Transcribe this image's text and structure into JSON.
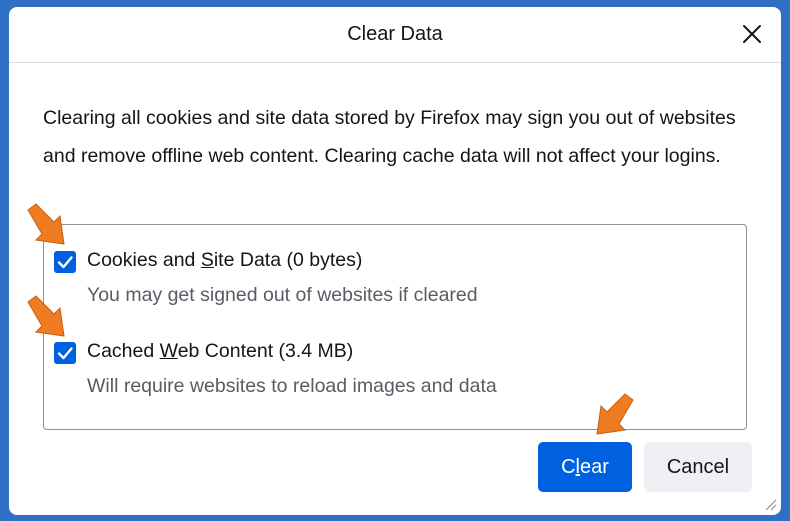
{
  "dialog": {
    "title": "Clear Data",
    "description": "Clearing all cookies and site data stored by Firefox may sign you out of websites and remove offline web content. Clearing cache data will not affect your logins."
  },
  "options": [
    {
      "label_before": "Cookies and ",
      "label_underlined": "S",
      "label_after": "ite Data (0 bytes)",
      "description": "You may get signed out of websites if cleared",
      "checked": true
    },
    {
      "label_before": "Cached ",
      "label_underlined": "W",
      "label_after": "eb Content (3.4 MB)",
      "description": "Will require websites to reload images and data",
      "checked": true
    }
  ],
  "buttons": {
    "clear_before": "C",
    "clear_underlined": "l",
    "clear_after": "ear",
    "cancel": "Cancel"
  },
  "icons": {
    "close": "close-icon",
    "checkbox": "checkmark-icon",
    "annotation": "arrow-pointer-icon",
    "resize": "resize-grip-icon"
  },
  "colors": {
    "accent": "#0061e0",
    "annotation_arrow": "#f07c22",
    "frame": "#2f6fc4"
  }
}
